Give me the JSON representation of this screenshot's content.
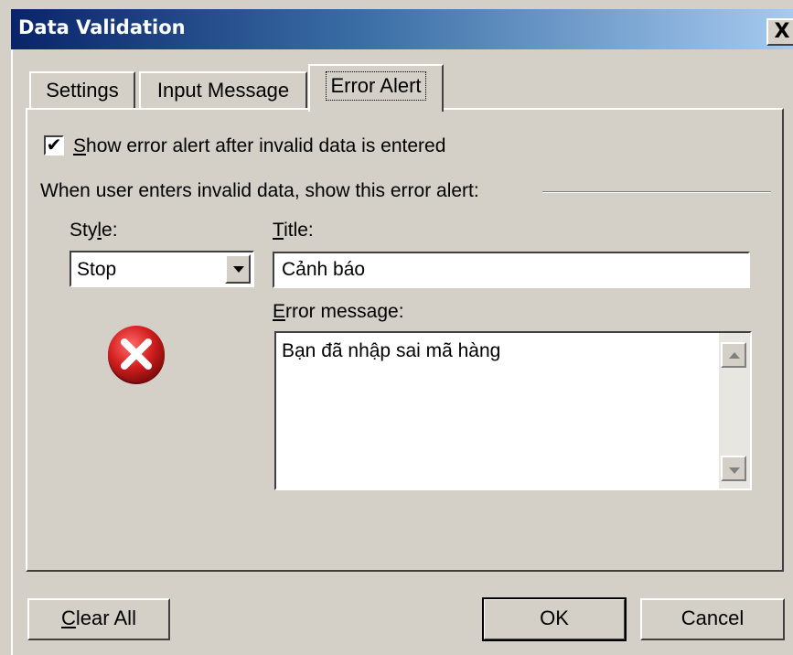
{
  "window": {
    "title": "Data Validation",
    "close_glyph": "X"
  },
  "tabs": [
    {
      "label": "Settings",
      "selected": false
    },
    {
      "label": "Input Message",
      "selected": false
    },
    {
      "label": "Error Alert",
      "selected": true
    }
  ],
  "error_alert": {
    "show_alert": {
      "checked": true,
      "check_glyph": "✔",
      "label_hotkey": "S",
      "label_rest": "how error alert after invalid data is entered"
    },
    "group_label": "When user enters invalid data, show this error alert:",
    "style": {
      "label_pre": "Sty",
      "label_hotkey": "l",
      "label_post": "e:",
      "value": "Stop",
      "icon": "stop-error-icon"
    },
    "title": {
      "label_hotkey": "T",
      "label_rest": "itle:",
      "value": "Cảnh báo"
    },
    "message": {
      "label_hotkey": "E",
      "label_rest": "rror message:",
      "value": "Bạn đã nhập sai mã hàng"
    }
  },
  "buttons": {
    "clear_hotkey": "C",
    "clear_rest": "lear All",
    "ok": "OK",
    "cancel": "Cancel"
  },
  "colors": {
    "dialog_bg": "#d4d0c8",
    "title_start": "#0a246a",
    "title_end": "#a6caf0",
    "stop_red": "#d21f1f"
  }
}
